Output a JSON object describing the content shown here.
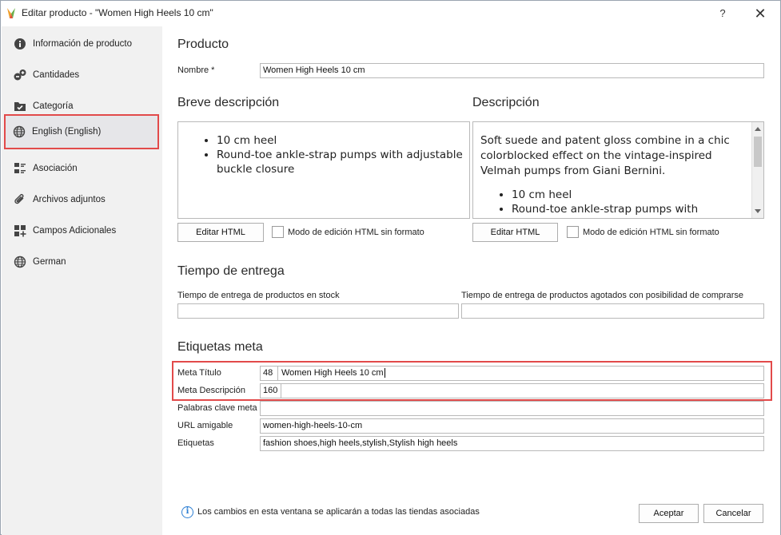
{
  "window": {
    "title": "Editar producto - \"Women High Heels 10 cm\"",
    "help": "?",
    "close": "✕"
  },
  "sidebar": {
    "items": [
      {
        "label": "Información de producto",
        "icon": "info-circle-icon"
      },
      {
        "label": "Cantidades",
        "icon": "quantities-icon"
      },
      {
        "label": "Categoría",
        "icon": "folder-check-icon"
      },
      {
        "label": "English (English)",
        "icon": "globe-icon",
        "active": true
      },
      {
        "label": "Asociación",
        "icon": "association-icon"
      },
      {
        "label": "Archivos adjuntos",
        "icon": "paperclip-icon"
      },
      {
        "label": "Campos Adicionales",
        "icon": "add-fields-icon"
      },
      {
        "label": "German",
        "icon": "globe-icon"
      }
    ]
  },
  "producto": {
    "heading": "Producto",
    "nombre_label": "Nombre *",
    "nombre_value": "Women High Heels 10 cm"
  },
  "breve": {
    "heading": "Breve descripción",
    "bullets": [
      "10 cm heel",
      "Round-toe ankle-strap pumps with adjustable buckle closure"
    ],
    "edit_html": "Editar HTML",
    "raw_mode": "Modo de edición HTML sin formato"
  },
  "descripcion": {
    "heading": "Descripción",
    "paragraph": "Soft suede and patent gloss combine in a chic colorblocked effect on the vintage-inspired Velmah pumps from Giani Bernini.",
    "bullets": [
      "10 cm heel",
      "Round-toe ankle-strap pumps with"
    ],
    "edit_html": "Editar HTML",
    "raw_mode": "Modo de edición HTML sin formato"
  },
  "entrega": {
    "heading": "Tiempo de entrega",
    "in_stock_label": "Tiempo de entrega de productos en stock",
    "in_stock_value": "",
    "out_stock_label": "Tiempo de entrega de productos agotados con posibilidad de comprarse",
    "out_stock_value": ""
  },
  "meta": {
    "heading": "Etiquetas meta",
    "titulo_label": "Meta Título",
    "titulo_count": "48",
    "titulo_value": "Women High Heels 10 cm",
    "descripcion_label": "Meta Descripción",
    "descripcion_count": "160",
    "descripcion_value": "",
    "palabras_label": "Palabras clave meta",
    "palabras_value": "",
    "url_label": "URL amigable",
    "url_value": "women-high-heels-10-cm",
    "etiquetas_label": "Etiquetas",
    "etiquetas_value": "fashion shoes,high heels,stylish,Stylish high heels"
  },
  "footer": {
    "info_text": "Los cambios en esta ventana se aplicarán a todas las tiendas asociadas",
    "accept": "Aceptar",
    "cancel": "Cancelar"
  },
  "colors": {
    "highlight": "#e24a4a",
    "info": "#2d7fd3",
    "sidebar_bg": "#f1f1f1"
  }
}
